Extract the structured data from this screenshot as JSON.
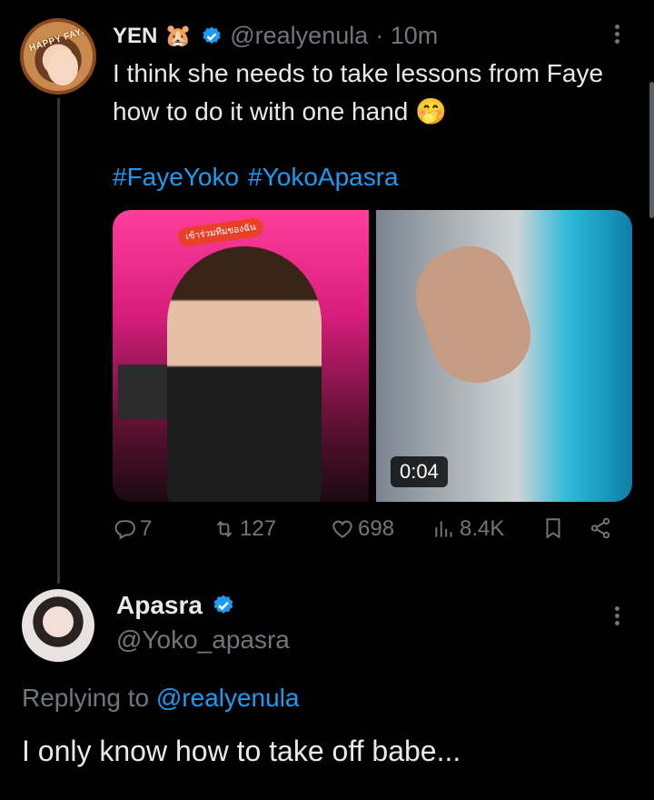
{
  "tweet": {
    "author_name": "YEN",
    "author_emoji": "🐹",
    "handle": "@realyenula",
    "time": "· 10m",
    "text": "I think she needs to take lessons from Faye how to do it with one hand 🤭",
    "hashtags": [
      "#FayeYoko",
      "#YokoApasra"
    ],
    "avatar_banner": "HAPPY FAYE'S DAY!",
    "media": {
      "left_badge": "เข้าร่วมทีมของฉัน",
      "duration": "0:04"
    },
    "actions": {
      "replies": "7",
      "retweets": "127",
      "likes": "698",
      "views": "8.4K"
    }
  },
  "reply": {
    "author_name": "Apasra",
    "handle": "@Yoko_apasra",
    "replying_to_label": "Replying to",
    "replying_to_handle": "@realyenula",
    "text": "I only know how to take off babe..."
  },
  "colors": {
    "background": "#000000",
    "text_primary": "#e7e9ea",
    "text_secondary": "#71767b",
    "accent": "#1d9bf0"
  }
}
